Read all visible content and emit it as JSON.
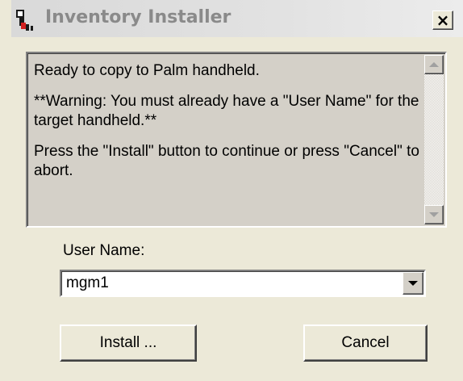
{
  "window": {
    "title": "Inventory Installer",
    "close_label": "×",
    "app_icon": "palm-installer-icon"
  },
  "message": {
    "line1": "Ready to copy to Palm handheld.",
    "line2": "**Warning:  You must already have a \"User Name\" for the target handheld.**",
    "line3": "Press the \"Install\" button to continue or press \"Cancel\" to abort."
  },
  "user": {
    "label": "User Name:",
    "selected": "mgm1"
  },
  "buttons": {
    "install": "Install ...",
    "cancel": "Cancel"
  },
  "colors": {
    "face": "#ece9d8",
    "titlebar": "#dcdcdc",
    "title_text": "#8a8a8a"
  }
}
